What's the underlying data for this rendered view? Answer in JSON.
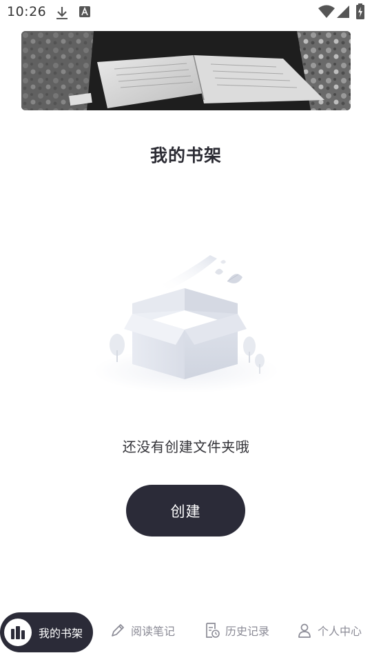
{
  "status_bar": {
    "time": "10:26"
  },
  "page": {
    "title": "我的书架",
    "empty_message": "还没有创建文件夹哦",
    "create_label": "创建"
  },
  "bottom_nav": {
    "items": [
      {
        "label": "我的书架",
        "icon": "bookshelf-icon",
        "active": true
      },
      {
        "label": "阅读笔记",
        "icon": "pencil-icon",
        "active": false
      },
      {
        "label": "历史记录",
        "icon": "history-record-icon",
        "active": false
      },
      {
        "label": "个人中心",
        "icon": "person-icon",
        "active": false
      }
    ]
  },
  "colors": {
    "accent_dark": "#2b2b38",
    "inactive": "#8a8a95",
    "background": "#ffffff"
  }
}
